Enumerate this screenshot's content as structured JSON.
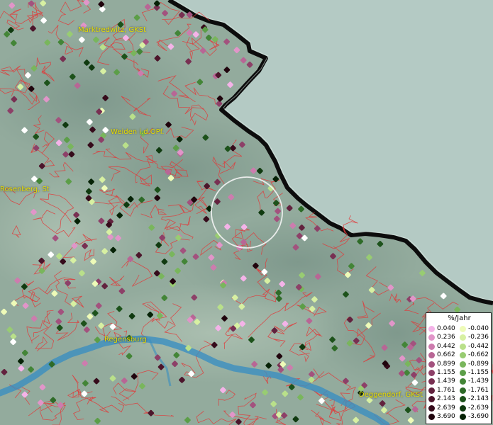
{
  "map": {
    "places": [
      {
        "id": "marktredwitz",
        "label": "Marktredwitz, GKSt"
      },
      {
        "id": "weiden",
        "label": "Weiden i.d.OPf."
      },
      {
        "id": "rosenberg",
        "label": "Rosenberg, St"
      },
      {
        "id": "regensburg",
        "label": "Regensburg"
      },
      {
        "id": "deggendorf",
        "label": "Deggendorf, GKSt"
      }
    ]
  },
  "legend": {
    "title": "%/Jahr",
    "positive": [
      {
        "value": "0.040",
        "color": "#f4b3e8"
      },
      {
        "value": "0.236",
        "color": "#e195c9"
      },
      {
        "value": "0.442",
        "color": "#cd7cae"
      },
      {
        "value": "0.662",
        "color": "#b86695"
      },
      {
        "value": "0.899",
        "color": "#a3527e"
      },
      {
        "value": "1.155",
        "color": "#8d4068"
      },
      {
        "value": "1.439",
        "color": "#783052"
      },
      {
        "value": "1.761",
        "color": "#62223e"
      },
      {
        "value": "2.143",
        "color": "#4c152b"
      },
      {
        "value": "2.639",
        "color": "#360b1b"
      },
      {
        "value": "3.690",
        "color": "#20040d"
      }
    ],
    "negative": [
      {
        "value": "-0.040",
        "color": "#eefbb8"
      },
      {
        "value": "-0.236",
        "color": "#d7f0a2"
      },
      {
        "value": "-0.442",
        "color": "#b9e08a"
      },
      {
        "value": "-0.662",
        "color": "#98cc72"
      },
      {
        "value": "-0.899",
        "color": "#79b65c"
      },
      {
        "value": "-1.155",
        "color": "#5c9e48"
      },
      {
        "value": "-1.439",
        "color": "#438537"
      },
      {
        "value": "-1.761",
        "color": "#2e6b28"
      },
      {
        "value": "-2.143",
        "color": "#1d521b"
      },
      {
        "value": "-2.639",
        "color": "#103a10"
      },
      {
        "value": "-3.690",
        "color": "#062206"
      }
    ]
  }
}
